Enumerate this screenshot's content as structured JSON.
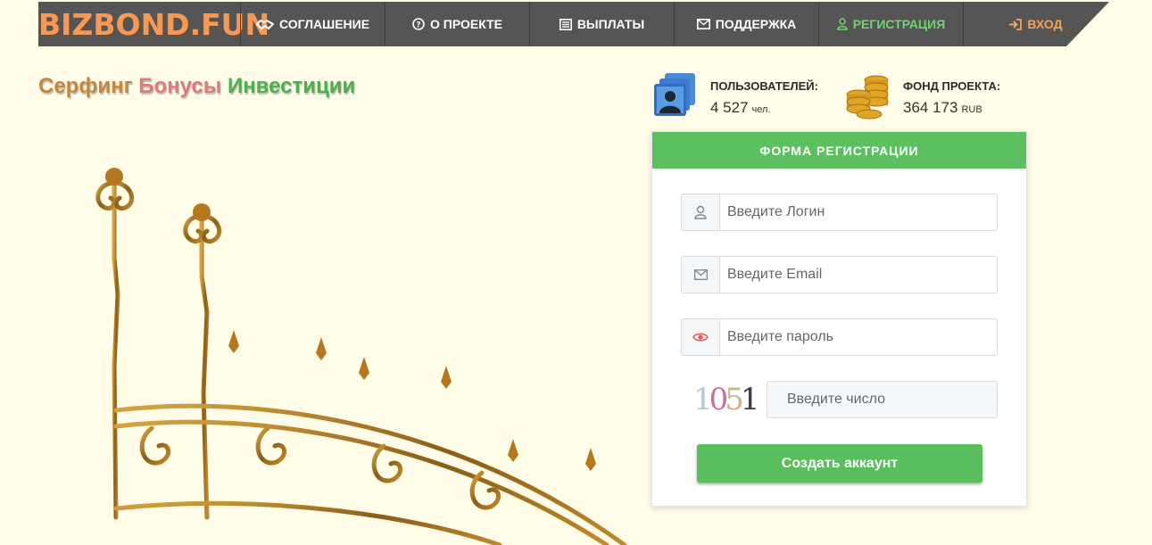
{
  "brand": {
    "logo": "BIZBOND.FUN"
  },
  "nav": {
    "items": [
      {
        "label": "СОГЛАШЕНИЕ",
        "icon": "handshake-icon"
      },
      {
        "label": "О ПРОЕКТЕ",
        "icon": "question-circle-icon"
      },
      {
        "label": "ВЫПЛАТЫ",
        "icon": "list-icon"
      },
      {
        "label": "ПОДДЕРЖКА",
        "icon": "envelope-icon"
      },
      {
        "label": "РЕГИСТРАЦИЯ",
        "icon": "user-icon"
      },
      {
        "label": "ВХОД",
        "icon": "sign-in-icon"
      }
    ],
    "colors": {
      "bar": "#555555",
      "active": "#6fd66f",
      "login": "#f6a156"
    }
  },
  "tagline": {
    "word1": "Серфинг",
    "word2": "Бонусы",
    "word3": "Инвестиции",
    "colors": [
      "#c9863a",
      "#e07a7a",
      "#4caf50"
    ]
  },
  "stats": {
    "users": {
      "label": "ПОЛЬЗОВАТЕЛЕЙ:",
      "value": "4 527",
      "unit": "чел.",
      "icon": "users-icon"
    },
    "fund": {
      "label": "ФОНД ПРОЕКТА:",
      "value": "364 173",
      "unit": "RUB",
      "icon": "coins-icon"
    }
  },
  "form": {
    "title": "ФОРМА РЕГИСТРАЦИИ",
    "login": {
      "placeholder": "Введите Логин",
      "value": "",
      "icon": "user-icon"
    },
    "email": {
      "placeholder": "Введите Email",
      "value": "",
      "icon": "envelope-icon"
    },
    "password": {
      "placeholder": "Введите пароль",
      "value": "",
      "icon": "eye-icon"
    },
    "captcha": {
      "digits": [
        "1",
        "0",
        "5",
        "1"
      ],
      "placeholder": "Введите число",
      "value": ""
    },
    "submit_label": "Создать аккаунт",
    "colors": {
      "header": "#5cbf60",
      "button": "#59be5c",
      "eye": "#e05a5a"
    }
  }
}
